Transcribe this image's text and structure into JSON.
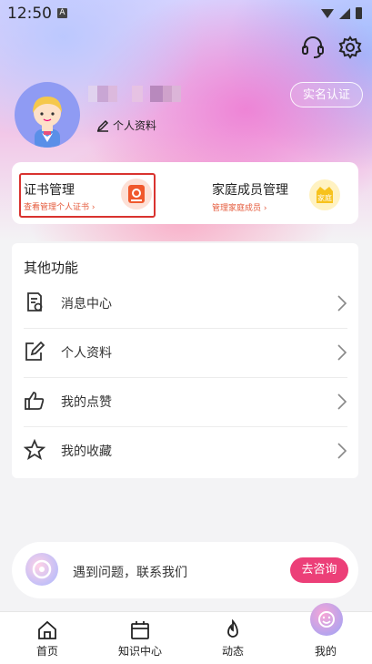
{
  "status_bar": {
    "time": "12:50",
    "notification_badge": "A"
  },
  "profile": {
    "edit_profile_label": "个人资料",
    "verify_button": "实名认证"
  },
  "features": {
    "certificate": {
      "title": "证书管理",
      "subtitle": "查看管理个人证书 ›"
    },
    "family": {
      "title": "家庭成员管理",
      "subtitle": "管理家庭成员 ›",
      "icon_label": "家庭"
    }
  },
  "other_functions": {
    "title": "其他功能",
    "items": [
      {
        "label": "消息中心",
        "icon": "message-doc-icon"
      },
      {
        "label": "个人资料",
        "icon": "edit-icon"
      },
      {
        "label": "我的点赞",
        "icon": "thumbs-up-icon"
      },
      {
        "label": "我的收藏",
        "icon": "star-icon"
      }
    ]
  },
  "help": {
    "text": "遇到问题，联系我们",
    "button": "去咨询"
  },
  "bottom_nav": [
    {
      "label": "首页",
      "icon": "home-icon"
    },
    {
      "label": "知识中心",
      "icon": "calendar-icon"
    },
    {
      "label": "动态",
      "icon": "flame-icon"
    },
    {
      "label": "我的",
      "icon": "smile-icon"
    }
  ],
  "colors": {
    "accent": "#ec3f78",
    "highlight_border": "#d9332f",
    "link_orange": "#e55b3c"
  }
}
